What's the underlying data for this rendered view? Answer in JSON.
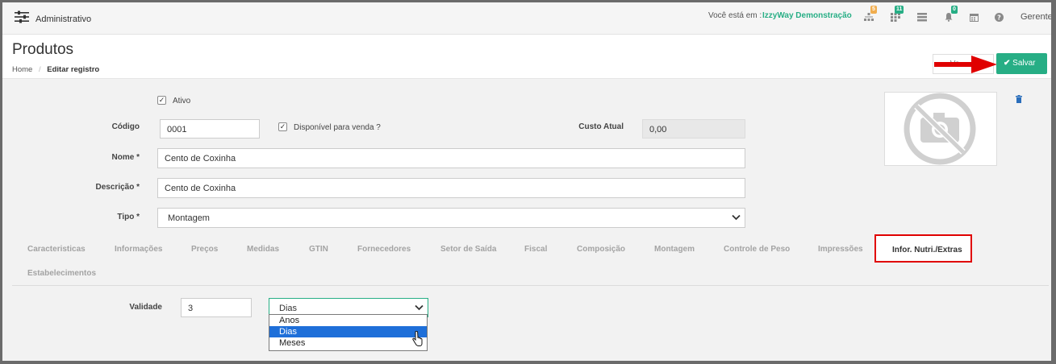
{
  "topbar": {
    "title": "Administrativo",
    "location_prefix": "Você está em :",
    "location_name": "IzzyWay Demonstração",
    "badge_orange": "5",
    "badge_green": "11",
    "badge_bell": "0",
    "user": "Gerente"
  },
  "page": {
    "title": "Produtos",
    "breadcrumb_home": "Home",
    "breadcrumb_sep": "/",
    "breadcrumb_current": "Editar registro",
    "back_label": "Vo",
    "save_label": "Salvar"
  },
  "form": {
    "ativo_label": "Ativo",
    "codigo_label": "Código",
    "codigo_value": "0001",
    "disponivel_label": "Disponível para venda ?",
    "custo_label": "Custo Atual",
    "custo_value": "0,00",
    "nome_label": "Nome *",
    "nome_value": "Cento de Coxinha",
    "descricao_label": "Descrição *",
    "descricao_value": "Cento de Coxinha",
    "tipo_label": "Tipo *",
    "tipo_value": "Montagem"
  },
  "tabs": [
    "Caracteristicas",
    "Informações",
    "Preços",
    "Medidas",
    "GTIN",
    "Fornecedores",
    "Setor de Saída",
    "Fiscal",
    "Composição",
    "Montagem",
    "Controle de Peso",
    "Impressões",
    "Infor. Nutri./Extras",
    "Estabelecimentos"
  ],
  "validade": {
    "label": "Validade",
    "value": "3",
    "unit_selected": "Dias",
    "options": [
      "Anos",
      "Dias",
      "Meses"
    ]
  },
  "colors": {
    "accent_green": "#27ae85",
    "highlight_red": "#e00000",
    "select_blue": "#1e6fd9"
  }
}
